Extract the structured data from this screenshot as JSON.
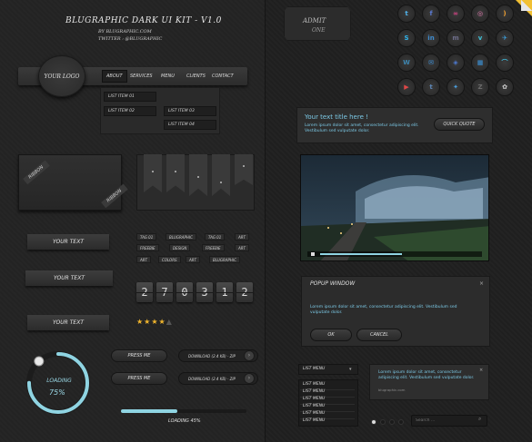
{
  "header": {
    "title": "BLUGRAPHIC DARK UI KIT - V1.0",
    "by": "BY BLUGRAPHIC.COM",
    "twitter": "TWITTER : @BLUGRAPHIC"
  },
  "nav": {
    "logo": "YOUR LOGO",
    "items": [
      "ABOUT",
      "SERVICES",
      "MENU",
      "CLIENTS",
      "CONTACT"
    ],
    "dropdown": [
      "LIST ITEM 01",
      "LIST ITEM 02",
      "LIST ITEM 03",
      "LIST ITEM 04"
    ]
  },
  "ribbon_card": {
    "ribbon_label": "RIBBON",
    "ribbon_label2": "RIBBON"
  },
  "ribbons": [
    "YOUR TEXT",
    "YOUR TEXT",
    "YOUR TEXT"
  ],
  "tags": [
    "TAG 01",
    "BLUGRAPHIC",
    "TAG 01",
    "ART",
    "FREEBIE",
    "DESIGN",
    "FREEBIE",
    "ART",
    "ART",
    "COLORS",
    "ART",
    "BLUGRAPHIC"
  ],
  "counter": [
    "2",
    "7",
    "0",
    "3",
    "1",
    "2"
  ],
  "rating": {
    "stars": 4,
    "max": 5,
    "color": "#f1b52d"
  },
  "loading": {
    "label": "LOADING",
    "percent_text": "75%",
    "progress": 0.75,
    "accent": "#8fd4e2"
  },
  "buttons": {
    "press1": "PRESS ME",
    "press2": "PRESS ME",
    "download1": "DOWNLOAD (2.4 KB) - ZIP",
    "download2": "DOWNLOAD (2.4 KB) - ZIP"
  },
  "progress_bar": {
    "label": "LOADING 45%",
    "value": 0.45
  },
  "ticket": {
    "line1": "ADMIT",
    "line2": "ONE"
  },
  "social": [
    {
      "icon": "twitter-icon",
      "glyph": "t",
      "color": "#4fb3ec"
    },
    {
      "icon": "facebook-icon",
      "glyph": "f",
      "color": "#5b7bd5"
    },
    {
      "icon": "flickr-icon",
      "glyph": "∞",
      "color": "#e0458b"
    },
    {
      "icon": "dribbble-icon",
      "glyph": "◎",
      "color": "#e57ab0"
    },
    {
      "icon": "rss-icon",
      "glyph": ")",
      "color": "#f0a030"
    },
    {
      "icon": "skype-icon",
      "glyph": "S",
      "color": "#2fb4ec"
    },
    {
      "icon": "linkedin-icon",
      "glyph": "in",
      "color": "#3e8ccf"
    },
    {
      "icon": "myspace-icon",
      "glyph": "m",
      "color": "#6d6d8a"
    },
    {
      "icon": "vimeo-icon",
      "glyph": "v",
      "color": "#3fc1d8"
    },
    {
      "icon": "delicious-icon",
      "glyph": "✈",
      "color": "#3aa0e0"
    },
    {
      "icon": "wordpress-icon",
      "glyph": "W",
      "color": "#3d85b0"
    },
    {
      "icon": "mail-icon",
      "glyph": "✉",
      "color": "#3a8fd8"
    },
    {
      "icon": "digg-icon",
      "glyph": "◈",
      "color": "#4d7ad3"
    },
    {
      "icon": "blogger-icon",
      "glyph": "▦",
      "color": "#3a96e0"
    },
    {
      "icon": "path-icon",
      "glyph": "⌒",
      "color": "#3fbfe0"
    },
    {
      "icon": "youtube-icon",
      "glyph": "▶",
      "color": "#e04848"
    },
    {
      "icon": "tumblr-icon",
      "glyph": "t",
      "color": "#5d86b6"
    },
    {
      "icon": "share-icon",
      "glyph": "✦",
      "color": "#4a9fe0"
    },
    {
      "icon": "zerply-icon",
      "glyph": "Z",
      "color": "#6a6a6a"
    },
    {
      "icon": "leaf-icon",
      "glyph": "✿",
      "color": "#d0d0d0"
    }
  ],
  "textbox": {
    "title": "Your text title here !",
    "body": "Lorem ipsum dolor sit amet, consectetur adipiscing elit. Vestibulum sed vulputate dolor.",
    "button": "QUICK QUOTE"
  },
  "popup": {
    "title": "POPUP WINDOW",
    "close": "×",
    "body": "Lorem ipsum dolor sit amet, consectetur adipiscing elit. Vestibulum sed vulputate dolor.",
    "ok": "OK",
    "cancel": "CANCEL"
  },
  "select": {
    "value": "LIST MENU",
    "options": [
      "LIST MENU",
      "LIST MENU",
      "LIST MENU",
      "LIST MENU",
      "LIST MENU",
      "LIST MENU"
    ]
  },
  "tooltip": {
    "body": "Lorem ipsum dolor sit amet, consectetur adipiscing elit. Vestibulum sed vulputate dolor.",
    "link": "blugraphic.com",
    "close": "×"
  },
  "search": {
    "placeholder": "Search ..."
  }
}
